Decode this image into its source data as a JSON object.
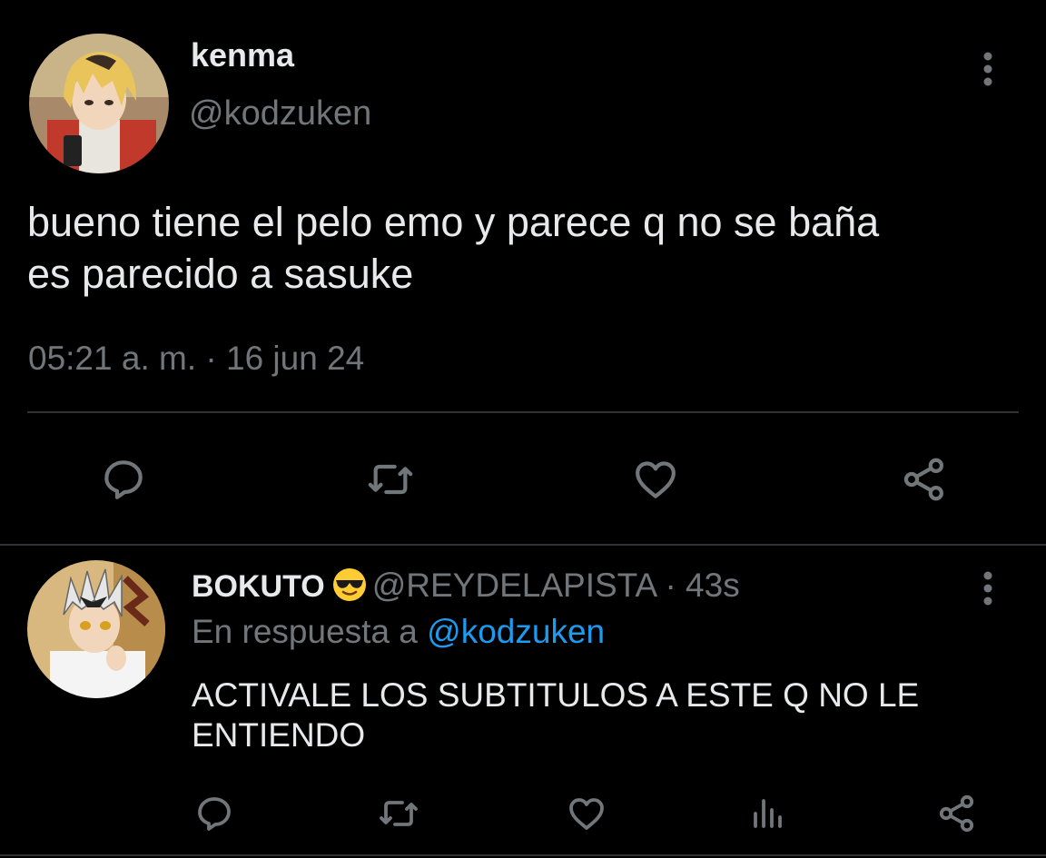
{
  "main_tweet": {
    "display_name": "kenma",
    "handle": "@kodzuken",
    "text": "bueno tiene el pelo emo y parece q no se baña\nes parecido a sasuke",
    "timestamp": "05:21 a. m. · 16 jun 24",
    "avatar_icon": "profile-avatar",
    "actions": [
      "reply-icon",
      "retweet-icon",
      "like-icon",
      "share-icon"
    ]
  },
  "reply": {
    "display_name": "BOKUTO",
    "emoji": "sunglasses-emoji",
    "handle": "@REYDELAPISTA",
    "separator": "·",
    "time": "43s",
    "reply_prefix": "En respuesta a",
    "reply_mention": "@kodzuken",
    "text": "ACTIVALE LOS SUBTITULOS A ESTE Q NO LE\nENTIENDO",
    "actions": [
      "reply-icon",
      "retweet-icon",
      "like-icon",
      "views-icon",
      "share-icon"
    ]
  },
  "colors": {
    "background": "#000000",
    "text_primary": "#e7e9ea",
    "text_secondary": "#71767b",
    "accent": "#1d9bf0",
    "divider": "#2f3336"
  }
}
